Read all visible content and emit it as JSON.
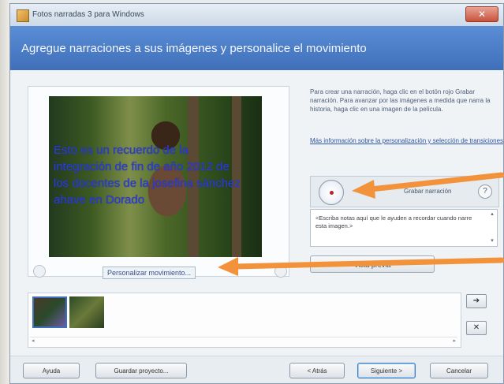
{
  "window": {
    "title": "Fotos narradas 3 para Windows",
    "close_glyph": "✕"
  },
  "header": {
    "title": "Agregue narraciones a sus imágenes y personalice el movimiento"
  },
  "preview": {
    "caption": "Esto es un recuerdo de la integración de fin de año 2012 de los docentes de la josefina sánchez ahave en Dorado",
    "personalize_label": "Personalizar movimiento..."
  },
  "info": {
    "text": "Para crear una narración, haga clic en el botón rojo Grabar narración. Para avanzar por las imágenes a medida que narra la historia, haga clic en una imagen de la película.",
    "link": "Más información sobre la personalización y selección de transiciones"
  },
  "narration": {
    "record_label": "Grabar narración",
    "help_glyph": "?",
    "notes": "<Escriba notas aquí que le ayuden a recordar cuando narre esta imagen.>"
  },
  "preview_button": "Vista previa",
  "filmstrip": {
    "next_glyph": "➔",
    "delete_glyph": "✕",
    "scroll_left": "◂",
    "scroll_right": "▸"
  },
  "footer": {
    "help": "Ayuda",
    "save": "Guardar proyecto...",
    "back": "< Atrás",
    "next": "Siguiente >",
    "cancel": "Cancelar"
  },
  "colors": {
    "header": "#4b7fc8",
    "annotation_arrow": "#f2933c"
  }
}
